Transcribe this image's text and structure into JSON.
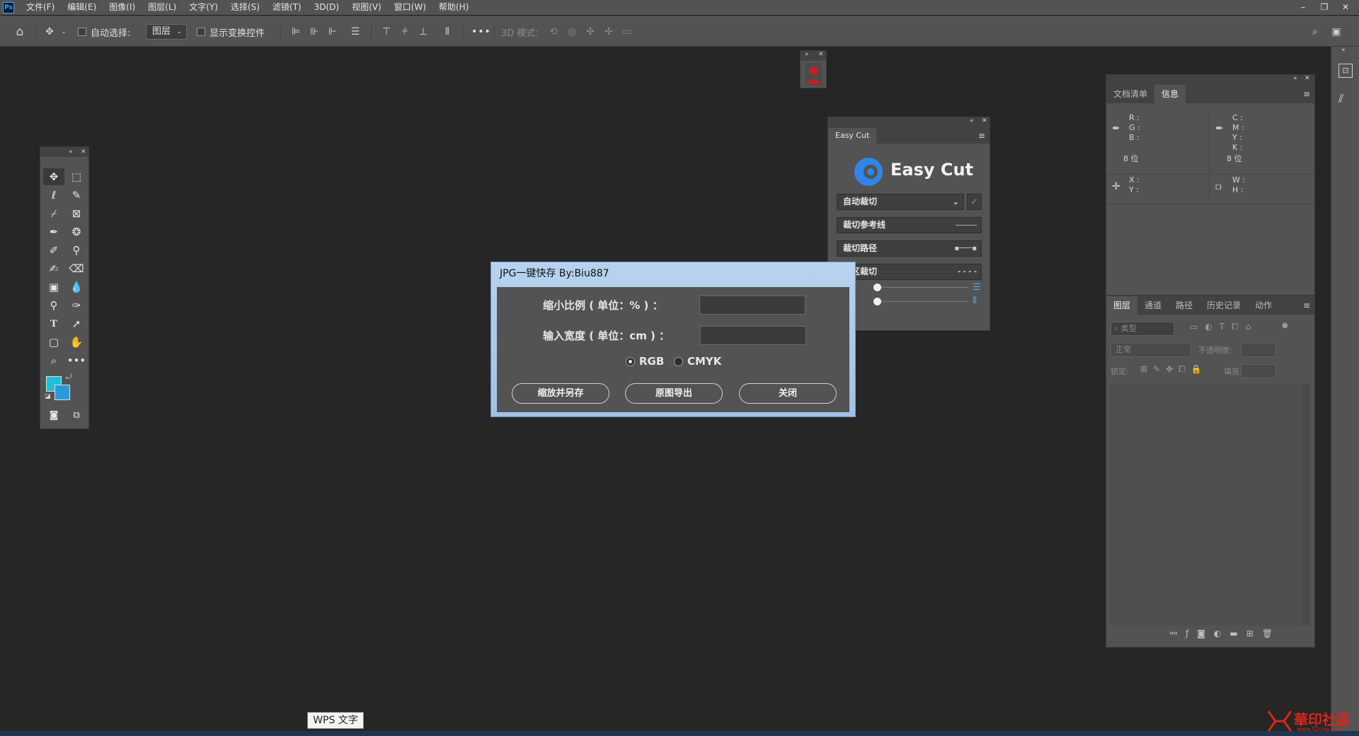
{
  "menubar": {
    "logo": "Ps",
    "items": [
      "文件(F)",
      "编辑(E)",
      "图像(I)",
      "图层(L)",
      "文字(Y)",
      "选择(S)",
      "滤镜(T)",
      "3D(D)",
      "视图(V)",
      "窗口(W)",
      "帮助(H)"
    ],
    "window_controls": [
      "–",
      "❐",
      "✕"
    ]
  },
  "options": {
    "auto_select_label": "自动选择:",
    "layer_select_value": "图层",
    "show_transform_label": "显示变换控件",
    "more": "•••",
    "mode_3d_label": "3D 模式:"
  },
  "portrait_panel": {
    "collapse": "»",
    "close": "✕"
  },
  "easycut": {
    "tab": "Easy Cut",
    "brand": "Easy Cut",
    "collapse": "«",
    "close": "✕",
    "menu": "≡",
    "rows": [
      "自动裁切",
      "裁切参考线",
      "裁切路径",
      "选区裁切"
    ]
  },
  "info_panel": {
    "tabs": [
      "文档清单",
      "信息"
    ],
    "active_tab": "信息",
    "collapse": "«",
    "close": "✕",
    "menu": "≡",
    "rgb_labels": "R :\nG :\nB :",
    "cmyk_labels": "C :\nM :\nY :\nK :",
    "bits_left": "8 位",
    "bits_right": "8 位",
    "xy_labels": "X :\nY :",
    "wh_labels": "W :\nH :"
  },
  "layers_panel": {
    "tabs": [
      "图层",
      "通道",
      "路径",
      "历史记录",
      "动作"
    ],
    "active_tab": "图层",
    "menu": "≡",
    "kind_placeholder": "类型",
    "blend_mode": "正常",
    "opacity_label": "不透明度:",
    "lock_label": "锁定:",
    "fill_label": "填充:"
  },
  "dialog": {
    "title": "JPG一键快存  By:Biu887",
    "scale_label": "缩小比例 ( 单位：% ) ：",
    "scale_value": "",
    "width_label": "输入宽度 ( 单位：cm ) ：",
    "width_value": "",
    "radio_rgb": "RGB",
    "radio_cmyk": "CMYK",
    "selected_mode": "RGB",
    "btn_scale_save": "缩放并另存",
    "btn_export": "原图导出",
    "btn_close": "关闭"
  },
  "taskbar": {
    "tooltip": "WPS 文字"
  },
  "watermark": {
    "text": "華印社區",
    "url": "www.52cnp.com"
  },
  "colors": {
    "foreground": "#1ec0d8",
    "background": "#2a9bd9",
    "easycut_logo": "#2f86e8"
  }
}
